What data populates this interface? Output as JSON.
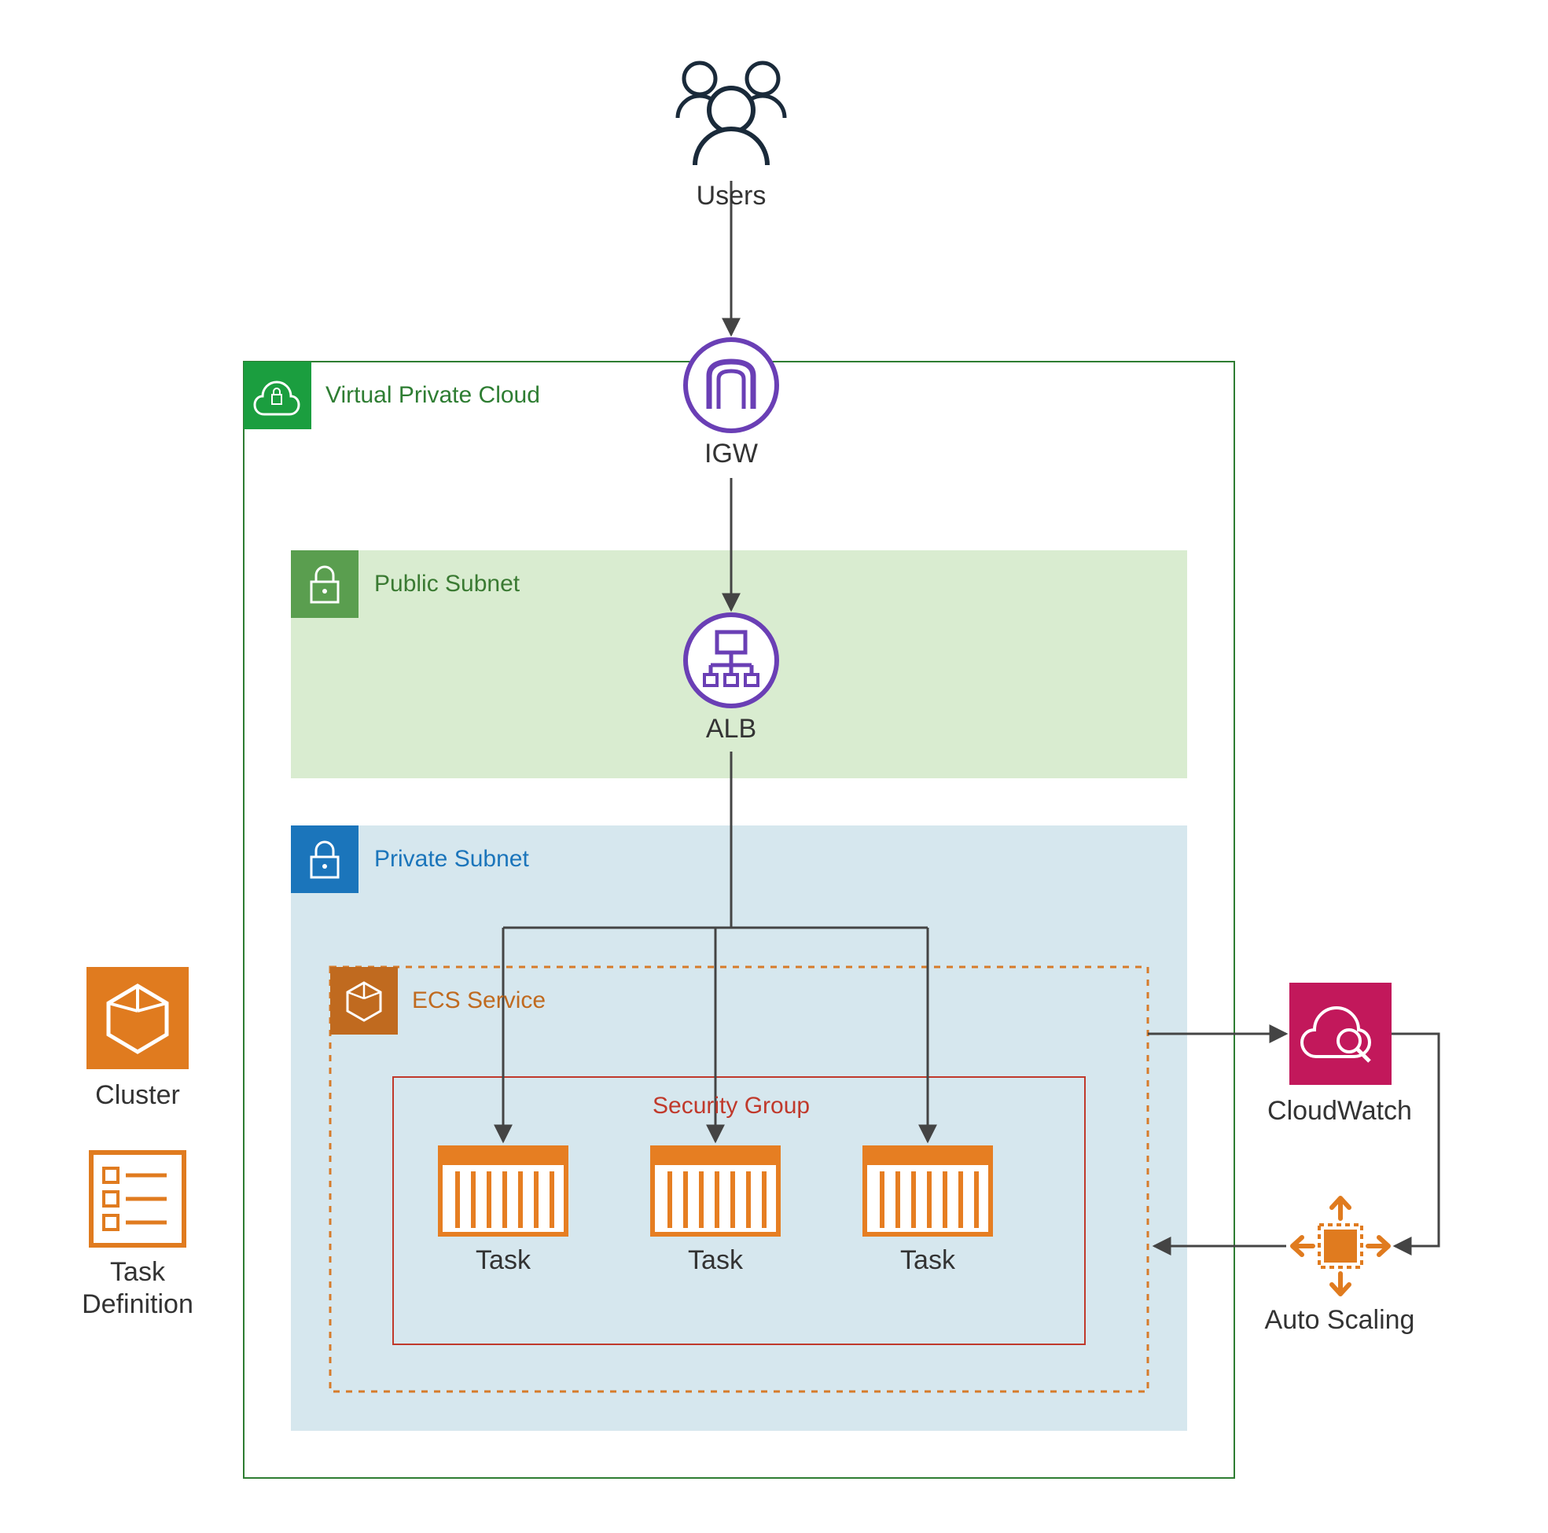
{
  "nodes": {
    "users": "Users",
    "igw": "IGW",
    "vpc": "Virtual Private Cloud",
    "publicSubnet": "Public Subnet",
    "alb": "ALB",
    "privateSubnet": "Private Subnet",
    "ecsService": "ECS Service",
    "securityGroup": "Security Group",
    "task1": "Task",
    "task2": "Task",
    "task3": "Task",
    "cluster": "Cluster",
    "taskDefinition": "Task\nDefinition",
    "cloudwatch": "CloudWatch",
    "autoscaling": "Auto Scaling"
  },
  "colors": {
    "vpcGreen": "#2e7d32",
    "vpcBadge": "#1b9e3f",
    "publicGreen": "#d9ecd0",
    "publicBadge": "#5a9e4f",
    "privateBlue": "#d6e7ee",
    "privateBadge": "#1b75bb",
    "ecsOrange": "#d77b2a",
    "ecsBadge": "#c06a1f",
    "sgRed": "#c0392b",
    "taskOrange": "#e67e22",
    "cwPink": "#c2185b",
    "purple": "#6a3fb5",
    "orange": "#e07b1f",
    "text": "#333333"
  }
}
